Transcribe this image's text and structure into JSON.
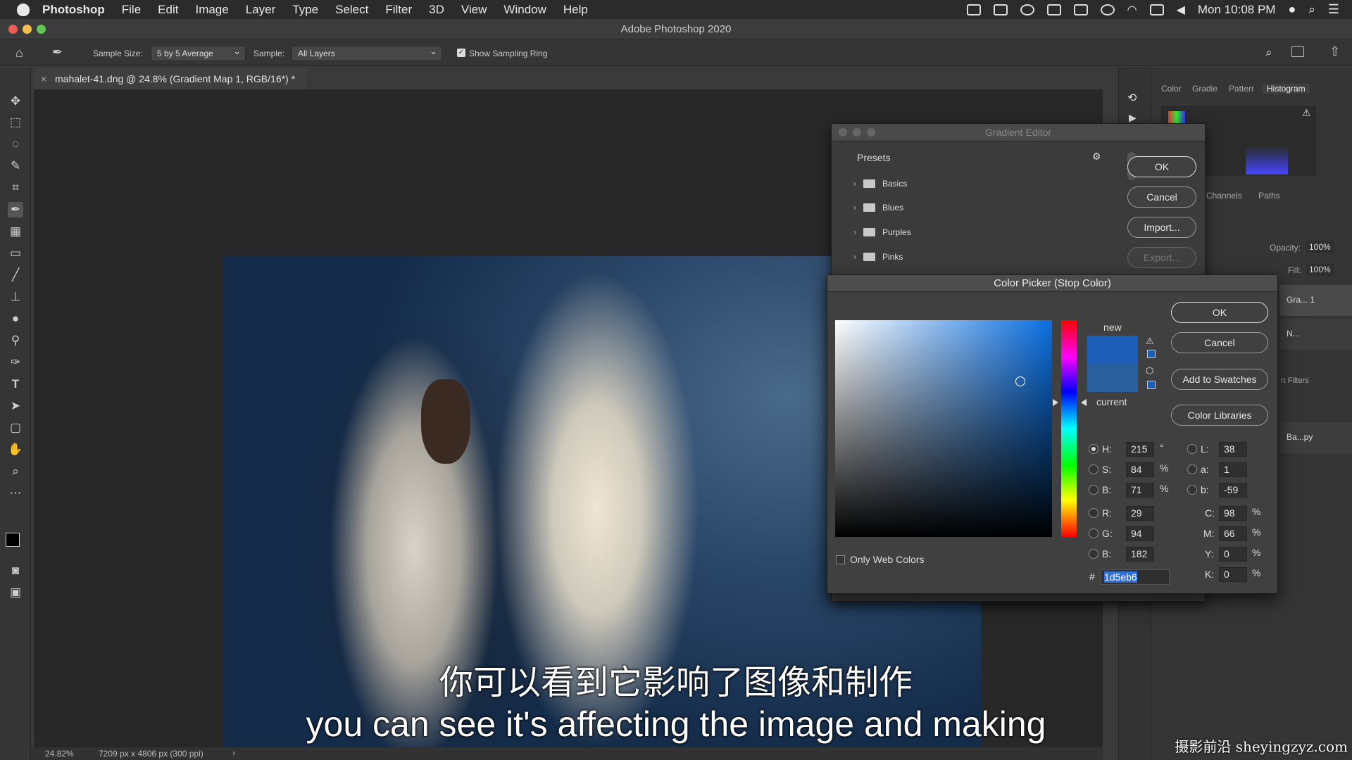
{
  "menubar": {
    "app": "Photoshop",
    "items": [
      "File",
      "Edit",
      "Image",
      "Layer",
      "Type",
      "Select",
      "Filter",
      "3D",
      "View",
      "Window",
      "Help"
    ],
    "clock": "Mon 10:08 PM"
  },
  "window_title": "Adobe Photoshop 2020",
  "options": {
    "sample_size_label": "Sample Size:",
    "sample_size_value": "5 by 5 Average",
    "sample_label": "Sample:",
    "sample_value": "All Layers",
    "show_ring_label": "Show Sampling Ring"
  },
  "document": {
    "tab_title": "mahalet-41.dng @ 24.8% (Gradient Map 1, RGB/16*) *",
    "zoom": "24.82%",
    "dimensions": "7209 px x 4806 px (300 ppi)"
  },
  "panels": {
    "tabs": [
      "Color",
      "Gradie",
      "Patterr",
      "Histogram"
    ],
    "layer_tabs": [
      "Channels",
      "Paths"
    ],
    "opacity_label": "Opacity:",
    "opacity": "100%",
    "fill_label": "Fill:",
    "fill": "100%",
    "layers": [
      "Gra... 1",
      "N...",
      "Ba...py"
    ],
    "smart_filters": "rt Filters"
  },
  "gradient_editor": {
    "title": "Gradient Editor",
    "presets_label": "Presets",
    "folders": [
      "Basics",
      "Blues",
      "Purples",
      "Pinks"
    ],
    "ok": "OK",
    "cancel": "Cancel",
    "import": "Import...",
    "export": "Export..."
  },
  "color_picker": {
    "title": "Color Picker (Stop Color)",
    "ok": "OK",
    "cancel": "Cancel",
    "add_swatches": "Add to Swatches",
    "color_libraries": "Color Libraries",
    "new_label": "new",
    "current_label": "current",
    "only_web": "Only Web Colors",
    "new_color": "#1d5eb6",
    "current_color": "#2a5f9e",
    "hsb": {
      "H": "215",
      "S": "84",
      "B": "71"
    },
    "rgb": {
      "R": "29",
      "G": "94",
      "B": "182"
    },
    "lab": {
      "L": "38",
      "a": "1",
      "b": "-59"
    },
    "cmyk": {
      "C": "98",
      "M": "66",
      "Y": "0",
      "K": "0"
    },
    "hex": "1d5eb6",
    "units": {
      "deg": "°",
      "pct": "%"
    }
  },
  "subtitles": {
    "zh": "你可以看到它影响了图像和制作",
    "en": "you can see it's affecting the image and making"
  },
  "watermark": "摄影前沿 sheyingzyz.com"
}
